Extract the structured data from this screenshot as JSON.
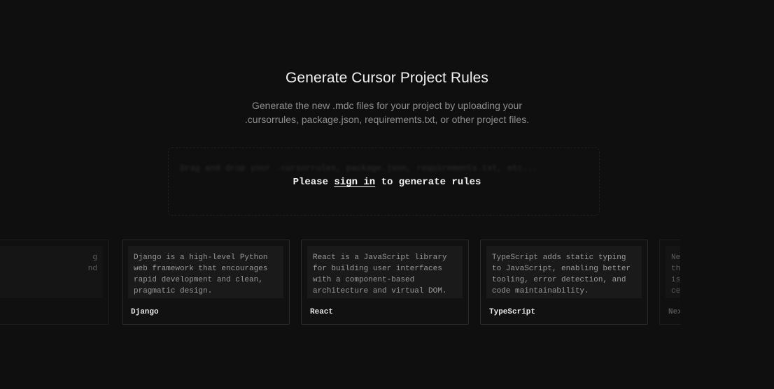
{
  "hero": {
    "title": "Generate Cursor Project Rules",
    "subtitle_line1": "Generate the new .mdc files for your project by uploading your",
    "subtitle_line2": ".cursorrules, package.json, requirements.txt, or other project files."
  },
  "dropzone": {
    "placeholder": "Drag and drop your .cursorrules, package.json, requirements.txt, etc..."
  },
  "signin": {
    "prefix": "Please ",
    "link_label": "sign in",
    "suffix": " to generate rules"
  },
  "cards": {
    "left_partial": {
      "lines": [
        "",
        "g",
        "nd",
        ""
      ],
      "name": ""
    },
    "django": {
      "lines": [
        "Django is a high-level Python",
        "web framework that encourages",
        "rapid development and clean,",
        "pragmatic design."
      ],
      "name": "Django"
    },
    "react": {
      "lines": [
        "React is a JavaScript library",
        "for building user interfaces",
        "with a component-based",
        "architecture and virtual DOM."
      ],
      "name": "React"
    },
    "typescript": {
      "lines": [
        "TypeScript adds static typing",
        "to JavaScript, enabling better",
        "tooling, error detection, and",
        "code maintainability."
      ],
      "name": "TypeScript"
    },
    "right_partial": {
      "lines": [
        "Ne",
        "th",
        "is",
        "ce"
      ],
      "name": "Nex"
    }
  },
  "colors": {
    "background": "#0f0f0f",
    "card_border": "#2b2b2b",
    "card_desc_bg": "#1a1a1a",
    "text_primary": "#f2f2f2",
    "text_muted": "#8e8e8e"
  }
}
